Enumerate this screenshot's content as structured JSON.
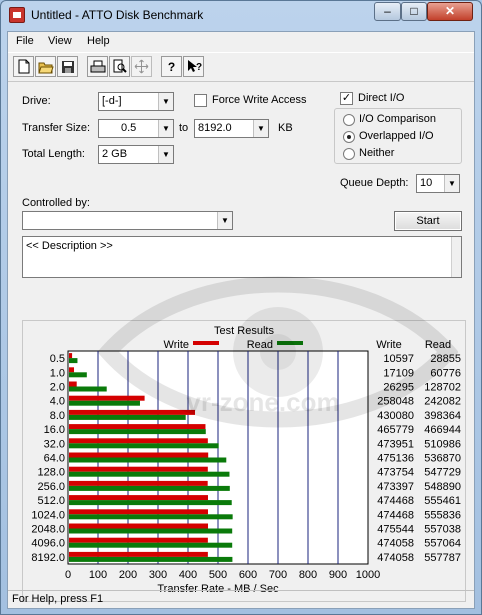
{
  "window": {
    "title": "Untitled - ATTO Disk Benchmark",
    "min_glyph": "–",
    "max_glyph": "□",
    "close_glyph": "✕"
  },
  "menu": {
    "file": "File",
    "view": "View",
    "help": "Help"
  },
  "toolbar": {
    "icons": [
      "new-document-icon",
      "open-folder-icon",
      "save-disk-icon",
      "print-icon",
      "print-preview-icon",
      "move-cross-icon",
      "help-question-icon",
      "context-help-icon"
    ]
  },
  "settings": {
    "drive_label": "Drive:",
    "drive_value": "[-d-]",
    "transfer_size_label": "Transfer Size:",
    "transfer_from": "0.5",
    "to_label": "to",
    "transfer_to": "8192.0",
    "kb_label": "KB",
    "total_length_label": "Total Length:",
    "total_length_value": "2 GB",
    "force_write_label": "Force Write Access",
    "force_write_checked": false,
    "direct_io_label": "Direct I/O",
    "direct_io_checked": true,
    "io_comparison_label": "I/O Comparison",
    "overlapped_io_label": "Overlapped I/O",
    "neither_label": "Neither",
    "selected_mode": "Overlapped I/O",
    "queue_depth_label": "Queue Depth:",
    "queue_depth_value": "10",
    "controlled_by_label": "Controlled by:",
    "controlled_by_value": "",
    "start_label": "Start",
    "description_text": "<< Description >>"
  },
  "results": {
    "title": "Test Results",
    "write_legend": "Write",
    "read_legend": "Read",
    "write_header": "Write",
    "read_header": "Read",
    "write_color": "#d40000",
    "read_color": "#0a7a0a",
    "watermark_text": "vr-zone.com"
  },
  "chart_data": {
    "type": "bar",
    "orientation": "horizontal",
    "title": "Test Results",
    "xlabel": "Transfer Rate - MB / Sec",
    "xlim": [
      0,
      1000
    ],
    "xticks": [
      "0",
      "100",
      "200",
      "300",
      "400",
      "500",
      "600",
      "700",
      "800",
      "900",
      "1000"
    ],
    "grid": true,
    "legend": "top",
    "categories": [
      "0.5",
      "1.0",
      "2.0",
      "4.0",
      "8.0",
      "16.0",
      "32.0",
      "64.0",
      "128.0",
      "256.0",
      "512.0",
      "1024.0",
      "2048.0",
      "4096.0",
      "8192.0"
    ],
    "series": [
      {
        "name": "Write",
        "color": "#d40000",
        "values": [
          10.3,
          16.7,
          25.7,
          252.0,
          420.0,
          454.9,
          462.8,
          464.0,
          462.7,
          462.3,
          463.3,
          463.3,
          463.4,
          462.9,
          462.9
        ]
      },
      {
        "name": "Read",
        "color": "#0a7a0a",
        "values": [
          28.2,
          59.4,
          125.7,
          236.6,
          389.0,
          455.9,
          499.0,
          524.3,
          534.9,
          536.0,
          542.4,
          545.5,
          544.0,
          544.0,
          544.7
        ]
      }
    ],
    "write_raw": [
      "10597",
      "17109",
      "26295",
      "258048",
      "430080",
      "465779",
      "473951",
      "475136",
      "473754",
      "473397",
      "474468",
      "474468",
      "475544",
      "474058",
      "474058"
    ],
    "read_raw": [
      "28855",
      "60776",
      "128702",
      "242082",
      "398364",
      "466944",
      "510986",
      "536870",
      "547729",
      "548890",
      "555461",
      "555836",
      "557038",
      "557064",
      "557787"
    ]
  },
  "status": {
    "text": "For Help, press F1"
  }
}
